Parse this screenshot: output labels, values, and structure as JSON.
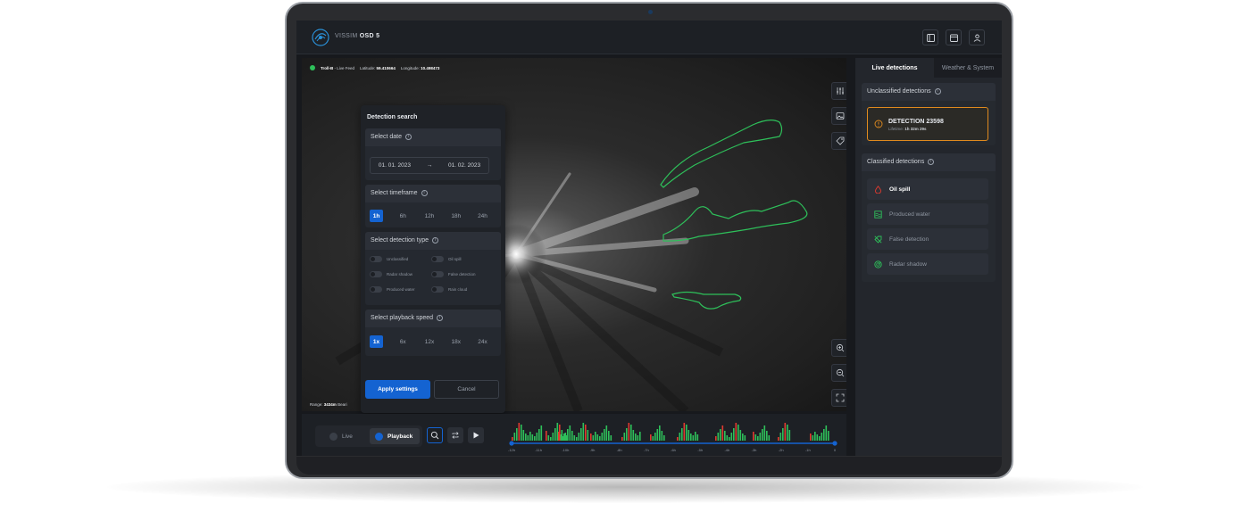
{
  "app": {
    "brand": "VISSIM",
    "product": "OSD 5"
  },
  "feed": {
    "status_dot_color": "#2ec05a",
    "source": "Troll-B",
    "source_suffix": " - Live Feed",
    "lat_label": "Latitude:",
    "lat_value": "59.410664",
    "lon_label": "Longitude:",
    "lon_value": "10.498473"
  },
  "range": {
    "label": "Range:",
    "value": "3434m",
    "trailing": "Beari"
  },
  "search": {
    "title": "Detection search",
    "date_label": "Select date",
    "date_from": "01. 01. 2023",
    "date_arrow": "→",
    "date_to": "01. 02. 2023",
    "timeframe_label": "Select timeframe",
    "timeframes": [
      "1h",
      "6h",
      "12h",
      "18h",
      "24h"
    ],
    "timeframe_active": "1h",
    "type_label": "Select detection type",
    "types": [
      "Unclassified",
      "Oil spill",
      "Radar shadow",
      "False detection",
      "Produced water",
      "Rain cloud"
    ],
    "speed_label": "Select playback speed",
    "speeds": [
      "1x",
      "6x",
      "12x",
      "18x",
      "24x"
    ],
    "speed_active": "1x",
    "apply_label": "Apply settings",
    "cancel_label": "Cancel"
  },
  "timeline": {
    "live_label": "Live",
    "playback_label": "Playback",
    "ticks": [
      "-12h",
      "-11h",
      "-10h",
      "-9h",
      "-8h",
      "-7h",
      "-6h",
      "-5h",
      "-4h",
      "-3h",
      "-2h",
      "-1h",
      "0"
    ],
    "accent": "#1463d1",
    "bar_green": "#2ec05a",
    "bar_red": "#e03a2f"
  },
  "sidebar": {
    "tabs": [
      "Live detections",
      "Weather & System"
    ],
    "unclassified_label": "Unclassified detections",
    "alert_title": "DETECTION 23598",
    "alert_lifetime_label": "Lifetime:",
    "alert_lifetime_value": "1h 32m 29s",
    "alert_color": "#e08a1e",
    "classified_label": "Classified detections",
    "classes": [
      {
        "label": "Oil spill",
        "icon": "droplet-icon",
        "color": "#e03a2f"
      },
      {
        "label": "Produced water",
        "icon": "water-icon",
        "color": "#2ec05a"
      },
      {
        "label": "False detection",
        "icon": "slash-icon",
        "color": "#2ec05a"
      },
      {
        "label": "Radar shadow",
        "icon": "radar-icon",
        "color": "#2ec05a"
      }
    ]
  }
}
